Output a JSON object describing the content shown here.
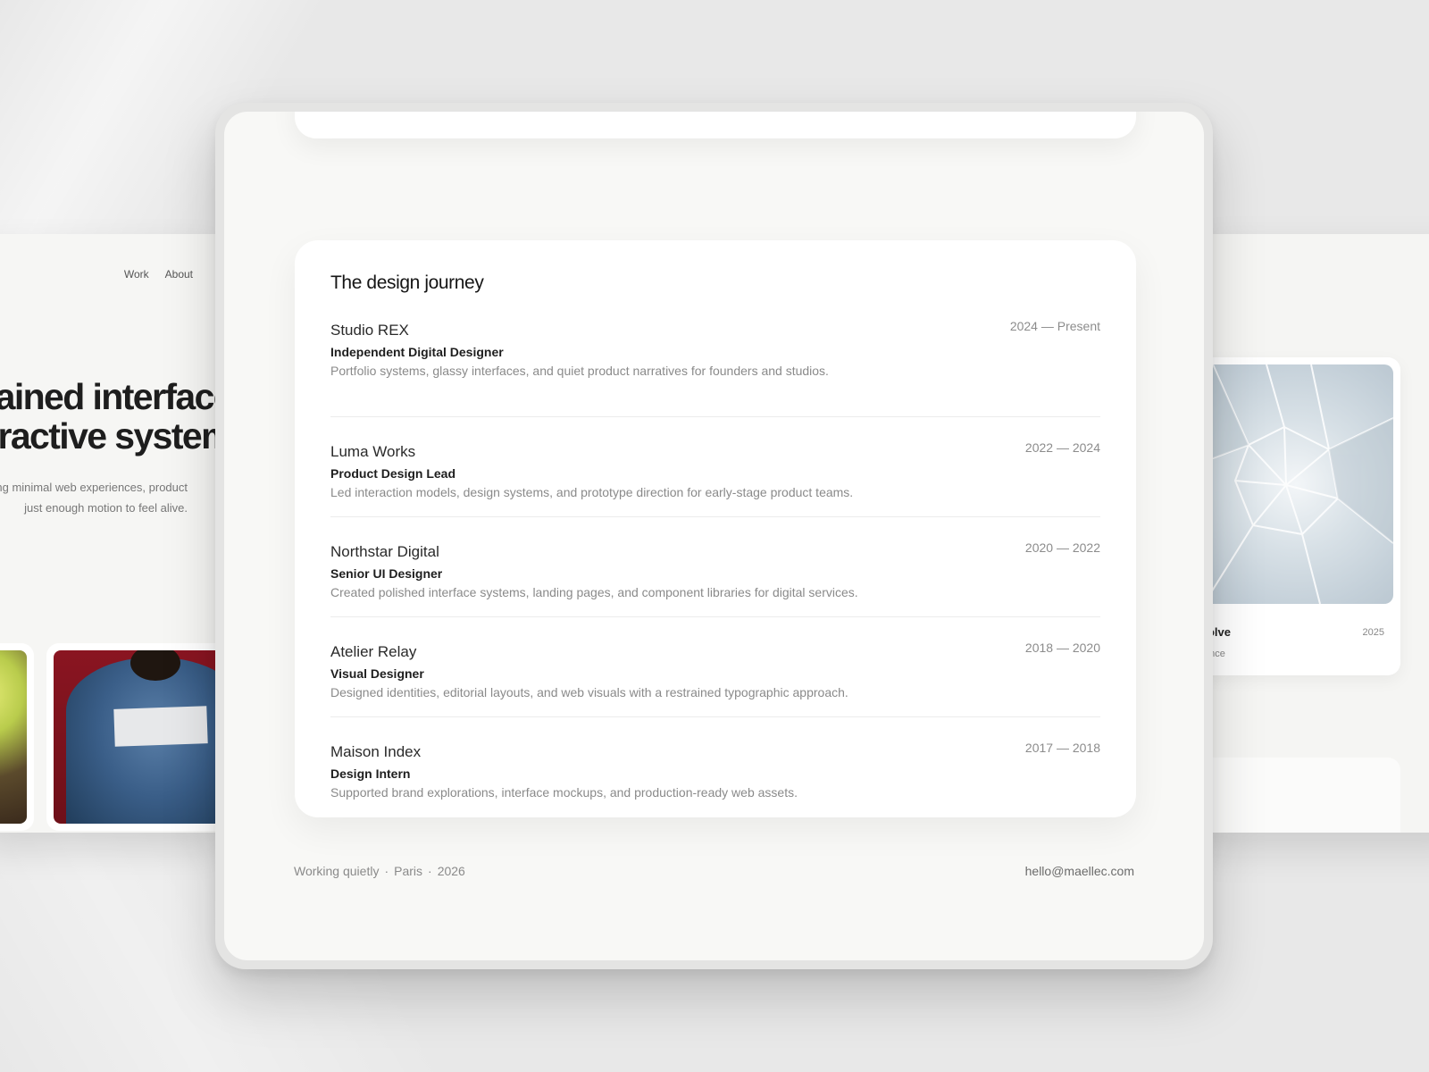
{
  "background_left": {
    "nav": [
      "Work",
      "About"
    ],
    "hero_lines": [
      "trained interface",
      "eractive system"
    ],
    "sub_lines": [
      "ing minimal web experiences, product",
      "just enough motion to feel alive."
    ]
  },
  "background_right": {
    "card_title": "ss Evolve",
    "card_year": "2025",
    "card_sub": "experience"
  },
  "journey": {
    "title": "The design journey",
    "entries": [
      {
        "company": "Studio REX",
        "role": "Independent Digital Designer",
        "description": "Portfolio systems, glassy interfaces, and quiet product narratives for founders and studios.",
        "dates": "2024 — Present"
      },
      {
        "company": "Luma Works",
        "role": "Product Design Lead",
        "description": "Led interaction models, design systems, and prototype direction for early-stage product teams.",
        "dates": "2022 — 2024"
      },
      {
        "company": "Northstar Digital",
        "role": "Senior UI Designer",
        "description": "Created polished interface systems, landing pages, and component libraries for digital services.",
        "dates": "2020 — 2022"
      },
      {
        "company": "Atelier Relay",
        "role": "Visual Designer",
        "description": "Designed identities, editorial layouts, and web visuals with a restrained typographic approach.",
        "dates": "2018 — 2020"
      },
      {
        "company": "Maison Index",
        "role": "Design Intern",
        "description": "Supported brand explorations, interface mockups, and production-ready web assets.",
        "dates": "2017 — 2018"
      }
    ]
  },
  "footer": {
    "status": "Working quietly",
    "separator": "·",
    "city": "Paris",
    "year": "2026",
    "email": "hello@maellec.com"
  }
}
